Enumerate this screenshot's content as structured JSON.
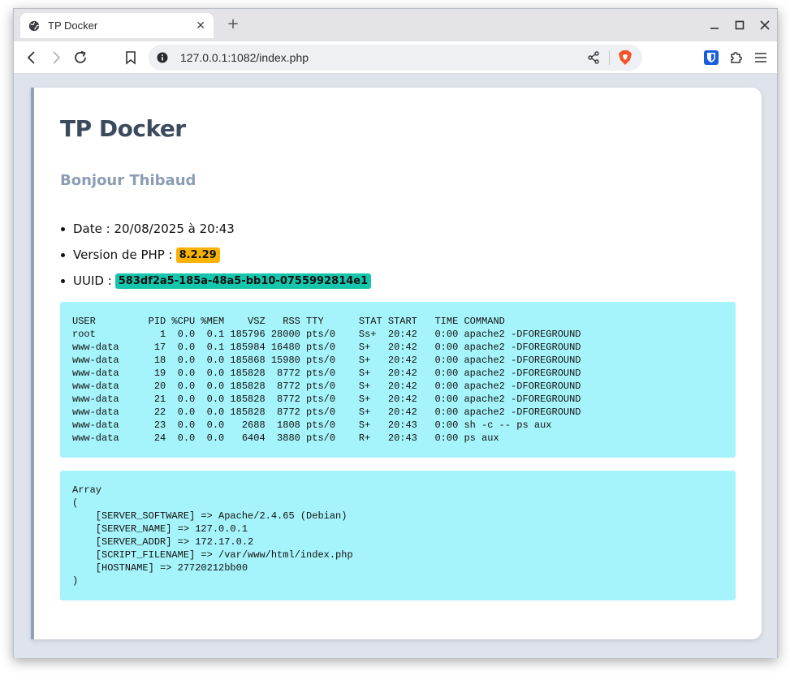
{
  "browser": {
    "tab_title": "TP Docker",
    "tab_close": "✕",
    "new_tab": "+",
    "url": "127.0.0.1:1082/index.php"
  },
  "page": {
    "title": "TP Docker",
    "subtitle": "Bonjour Thibaud",
    "date_text": "Date : 20/08/2025 à 20:43",
    "php_label": "Version de PHP :",
    "php_version": "8.2.29",
    "uuid_label": "UUID :",
    "uuid_value": "583df2a5-185a-48a5-bb10-0755992814e1",
    "ps_output": "USER         PID %CPU %MEM    VSZ   RSS TTY      STAT START   TIME COMMAND\nroot           1  0.0  0.1 185796 28000 pts/0    Ss+  20:42   0:00 apache2 -DFOREGROUND\nwww-data      17  0.0  0.1 185984 16480 pts/0    S+   20:42   0:00 apache2 -DFOREGROUND\nwww-data      18  0.0  0.0 185868 15980 pts/0    S+   20:42   0:00 apache2 -DFOREGROUND\nwww-data      19  0.0  0.0 185828  8772 pts/0    S+   20:42   0:00 apache2 -DFOREGROUND\nwww-data      20  0.0  0.0 185828  8772 pts/0    S+   20:42   0:00 apache2 -DFOREGROUND\nwww-data      21  0.0  0.0 185828  8772 pts/0    S+   20:42   0:00 apache2 -DFOREGROUND\nwww-data      22  0.0  0.0 185828  8772 pts/0    S+   20:42   0:00 apache2 -DFOREGROUND\nwww-data      23  0.0  0.0   2688  1808 pts/0    S+   20:43   0:00 sh -c -- ps aux\nwww-data      24  0.0  0.0   6404  3880 pts/0    R+   20:43   0:00 ps aux",
    "server_output": "Array\n(\n    [SERVER_SOFTWARE] => Apache/2.4.65 (Debian)\n    [SERVER_NAME] => 127.0.0.1\n    [SERVER_ADDR] => 172.17.0.2\n    [SCRIPT_FILENAME] => /var/www/html/index.php\n    [HOSTNAME] => 27720212bb00\n)"
  },
  "colors": {
    "php_badge": "#f9b305",
    "uuid_badge": "#15c6ad",
    "pre_background": "#a6f4fb",
    "card_accent": "#8fa0b8"
  },
  "icons": [
    "globe-icon",
    "close-icon",
    "plus-icon",
    "minimize-icon",
    "maximize-icon",
    "window-close-icon",
    "back-icon",
    "forward-icon",
    "reload-icon",
    "bookmark-icon",
    "info-icon",
    "share-icon",
    "brave-shield-icon",
    "bitwarden-icon",
    "extensions-icon",
    "menu-icon"
  ]
}
